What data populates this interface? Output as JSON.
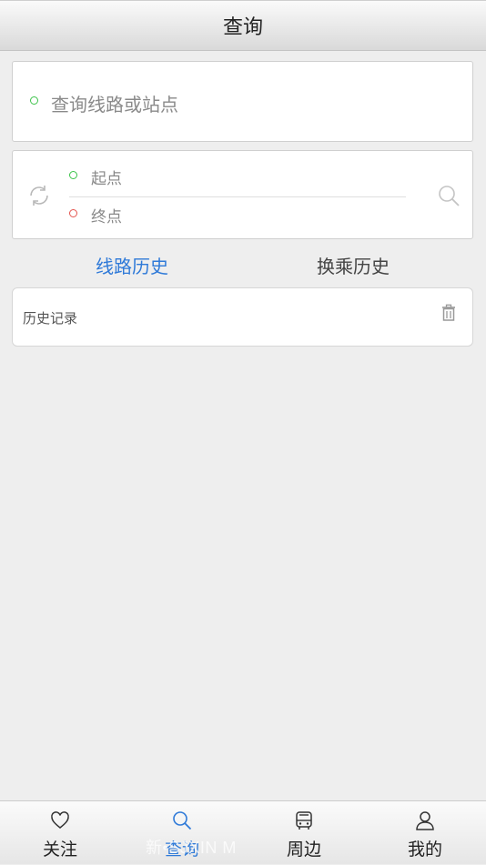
{
  "header": {
    "title": "查询"
  },
  "search": {
    "placeholder": "查询线路或站点"
  },
  "route": {
    "start_label": "起点",
    "end_label": "终点"
  },
  "tabs": [
    {
      "label": "线路历史",
      "active": true
    },
    {
      "label": "换乘历史",
      "active": false
    }
  ],
  "history": {
    "label": "历史记录"
  },
  "nav": [
    {
      "label": "关注",
      "icon": "heart-icon",
      "active": false
    },
    {
      "label": "查询",
      "icon": "search-icon",
      "active": true
    },
    {
      "label": "周边",
      "icon": "bus-icon",
      "active": false
    },
    {
      "label": "我的",
      "icon": "user-icon",
      "active": false
    }
  ],
  "watermark": "新•SJXIN  M",
  "colors": {
    "accent": "#2f7ad8",
    "start_dot": "#3cc34a",
    "end_dot": "#e4544e"
  }
}
